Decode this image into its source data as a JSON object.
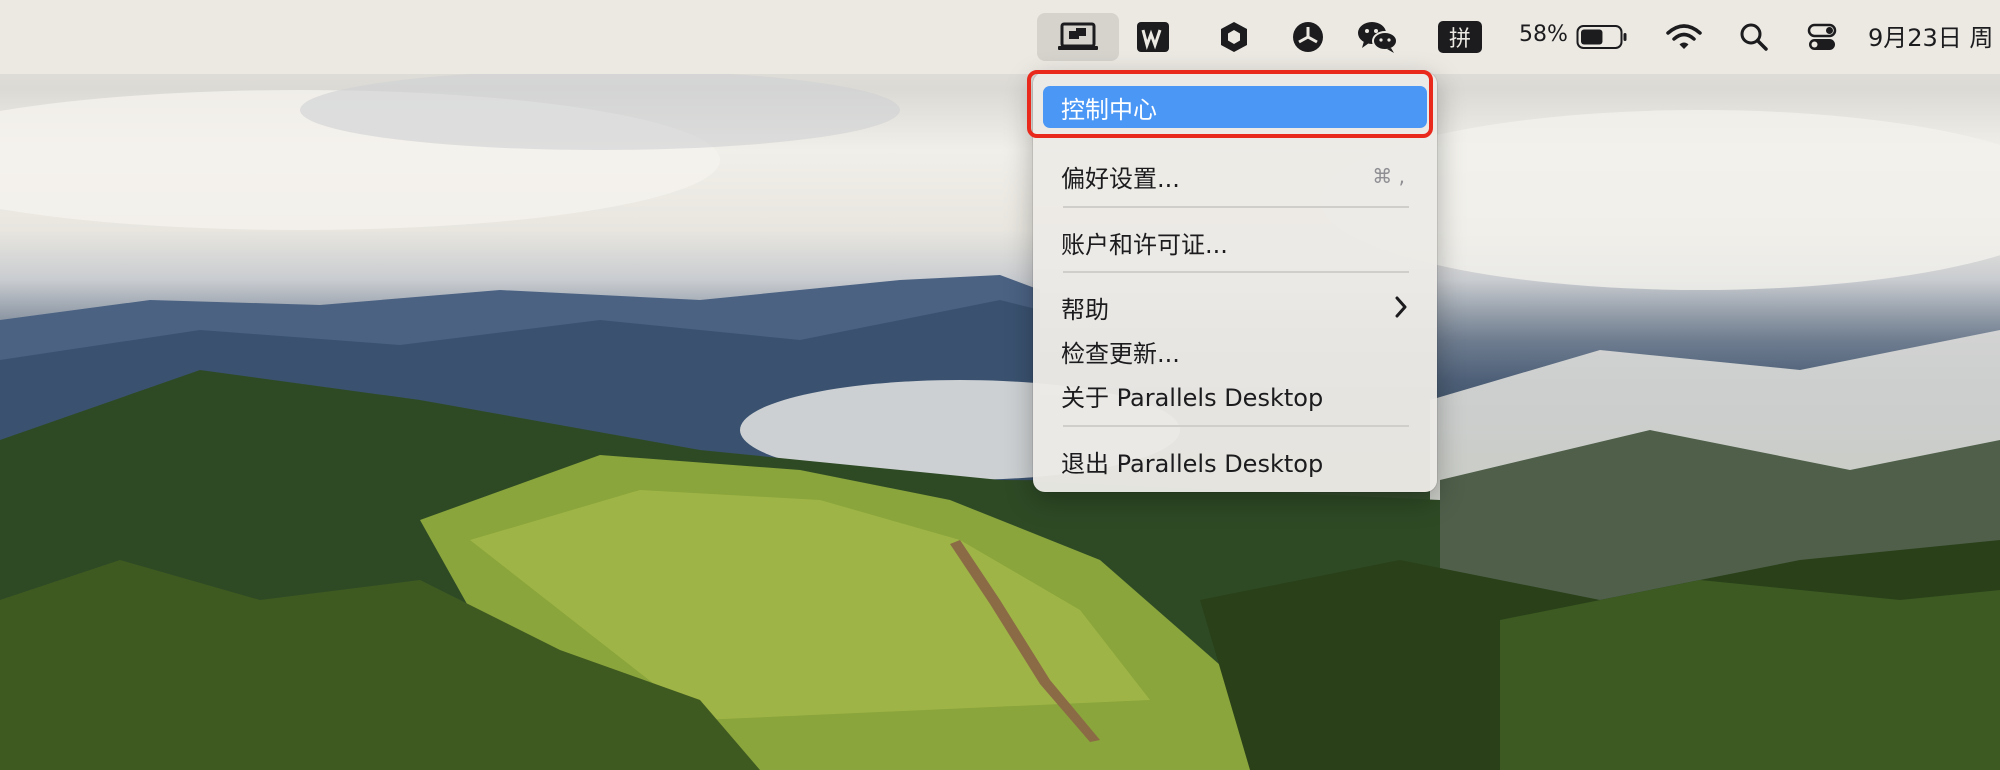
{
  "menubar": {
    "icons": [
      {
        "name": "parallels-icon",
        "active": true
      },
      {
        "name": "wps-icon"
      },
      {
        "name": "hexagon-app-icon"
      },
      {
        "name": "aperture-app-icon"
      },
      {
        "name": "wechat-icon"
      },
      {
        "name": "input-method-icon",
        "label": "拼"
      }
    ],
    "battery_percent": "58%",
    "battery_level": 0.58,
    "clock": "9月23日 周"
  },
  "menu": {
    "items": [
      {
        "label": "控制中心",
        "highlighted": true
      },
      {
        "label": "偏好设置...",
        "shortcut": "⌘ ,"
      },
      {
        "label": "账户和许可证..."
      },
      {
        "label": "帮助",
        "submenu": true
      },
      {
        "label": "检查更新..."
      },
      {
        "label": "关于 Parallels Desktop"
      },
      {
        "label": "退出 Parallels Desktop"
      }
    ]
  },
  "colors": {
    "highlight": "#4b97f5",
    "focus_outline": "#e8291c",
    "menubar_bg": "#ece9e3"
  }
}
